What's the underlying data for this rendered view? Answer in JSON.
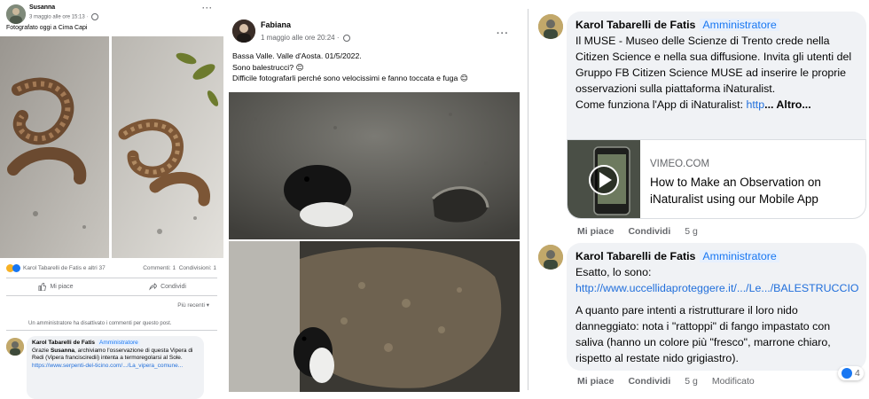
{
  "post1": {
    "author": "Susanna",
    "date": "3 maggio alle ore 15:13",
    "text": "Fotografato oggi a Cima Capi",
    "reactions_text": "Karol Tabarelli de Fatis e altri 37",
    "comments_count": "Commenti: 1",
    "shares_count": "Condivisioni: 1",
    "like_label": "Mi piace",
    "share_label": "Condividi",
    "sort_label": "Più recenti",
    "disabled_note": "Un amministratore ha disattivato i commenti per questo post.",
    "comment": {
      "author": "Karol Tabarelli de Fatis",
      "role": "Amministratore",
      "text_before": "Grazie ",
      "mention": "Susanna",
      "text_after": ", archiviamo l'osservazione di questa Vipera di Redi (Vipera francisciredii) intenta a termoregolarsi al Sole.",
      "link": "https://www.serpenti-del-ticino.com/.../La_vipera_comune..."
    }
  },
  "post2": {
    "author": "Fabiana",
    "date": "1 maggio alle ore 20:24",
    "text_lines": [
      "Bassa Valle. Valle d'Aosta. 01/5/2022.",
      "Sono balestrucci? 😊",
      "Difficile fotografarli perché sono velocissimi e fanno toccata e fuga 😊"
    ]
  },
  "post3": {
    "comment1": {
      "author": "Karol Tabarelli de Fatis",
      "role": "Amministratore",
      "text": "Il MUSE - Museo delle Scienze di Trento crede nella Citizen Science e nella sua diffusione. Invita gli utenti del Gruppo FB Citizen Science MUSE ad inserire le proprie osservazioni sulla piattaforma iNaturalist.",
      "text2": "Come funziona l'App di iNaturalist: ",
      "link": "http",
      "more": "... Altro...",
      "link_domain": "VIMEO.COM",
      "link_title": "How to Make an Observation on iNaturalist using our Mobile App",
      "like": "Mi piace",
      "share": "Condividi",
      "time": "5 g"
    },
    "comment2": {
      "author": "Karol Tabarelli de Fatis",
      "role": "Amministratore",
      "line1": "Esatto, lo sono:",
      "link": "http://www.uccellidaproteggere.it/.../Le.../BALESTRUCCIO",
      "text": "A quanto pare intenti a ristrutturare il loro nido danneggiato: nota i \"rattoppi\" di fango impastato con saliva (hanno un colore più \"fresco\", marrone chiaro, rispetto al restate nido grigiastro).",
      "like": "Mi piace",
      "share": "Condividi",
      "time": "5 g",
      "edited": "Modificato",
      "reaction_count": "4"
    }
  },
  "colors": {
    "link": "#216fdb",
    "admin_badge": "#1877f2",
    "bubble": "#f0f2f5",
    "muted": "#65676b"
  }
}
